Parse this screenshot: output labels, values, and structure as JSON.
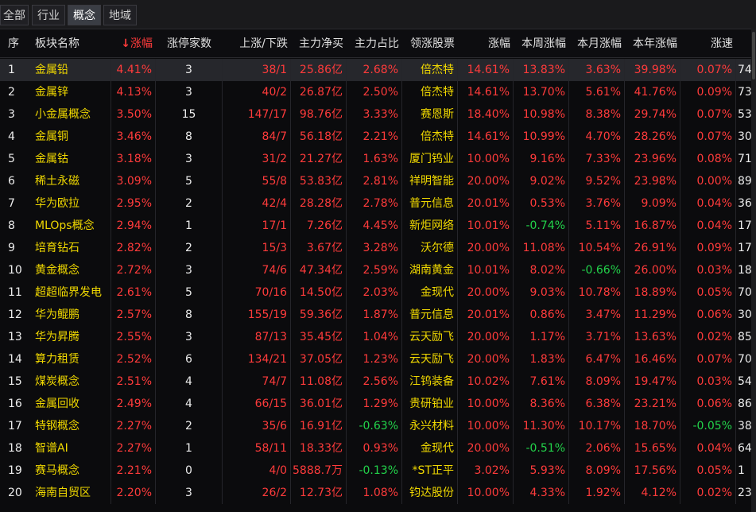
{
  "tabs": [
    {
      "label": "全部",
      "active": false
    },
    {
      "label": "行业",
      "active": false
    },
    {
      "label": "概念",
      "active": true
    },
    {
      "label": "地域",
      "active": false
    }
  ],
  "header": {
    "seq": "序",
    "name": "板块名称",
    "sort_arrow": "↓",
    "change": "涨幅",
    "limit_up": "涨停家数",
    "up_down": "上涨/下跌",
    "net_inflow": "主力净买",
    "main_ratio": "主力占比",
    "leader": "领涨股票",
    "leader_change": "涨幅",
    "week": "本周涨幅",
    "month": "本月涨幅",
    "year": "本年涨幅",
    "speed": "涨速",
    "extra": ""
  },
  "rows": [
    {
      "seq": "1",
      "name": "金属铅",
      "change": "4.41%",
      "limit_up": "3",
      "up_down": "38/1",
      "net": "25.86亿",
      "ratio": "2.68%",
      "leader": "倍杰特",
      "lchg": "14.61%",
      "week": "13.83%",
      "month": "3.63%",
      "year": "39.98%",
      "speed": "0.07%",
      "extra": "74"
    },
    {
      "seq": "2",
      "name": "金属锌",
      "change": "4.13%",
      "limit_up": "3",
      "up_down": "40/2",
      "net": "26.87亿",
      "ratio": "2.50%",
      "leader": "倍杰特",
      "lchg": "14.61%",
      "week": "13.70%",
      "month": "5.61%",
      "year": "41.76%",
      "speed": "0.09%",
      "extra": "73"
    },
    {
      "seq": "3",
      "name": "小金属概念",
      "change": "3.50%",
      "limit_up": "15",
      "up_down": "147/17",
      "net": "98.76亿",
      "ratio": "3.33%",
      "leader": "赛恩斯",
      "lchg": "18.40%",
      "week": "10.98%",
      "month": "8.38%",
      "year": "29.74%",
      "speed": "0.07%",
      "extra": "53"
    },
    {
      "seq": "4",
      "name": "金属铜",
      "change": "3.46%",
      "limit_up": "8",
      "up_down": "84/7",
      "net": "56.18亿",
      "ratio": "2.21%",
      "leader": "倍杰特",
      "lchg": "14.61%",
      "week": "10.99%",
      "month": "4.70%",
      "year": "28.26%",
      "speed": "0.07%",
      "extra": "30"
    },
    {
      "seq": "5",
      "name": "金属钴",
      "change": "3.18%",
      "limit_up": "3",
      "up_down": "31/2",
      "net": "21.27亿",
      "ratio": "1.63%",
      "leader": "厦门钨业",
      "lchg": "10.00%",
      "week": "9.16%",
      "month": "7.33%",
      "year": "23.96%",
      "speed": "0.08%",
      "extra": "71"
    },
    {
      "seq": "6",
      "name": "稀土永磁",
      "change": "3.09%",
      "limit_up": "5",
      "up_down": "55/8",
      "net": "53.83亿",
      "ratio": "2.81%",
      "leader": "祥明智能",
      "lchg": "20.00%",
      "week": "9.02%",
      "month": "9.52%",
      "year": "23.98%",
      "speed": "0.00%",
      "extra": "89"
    },
    {
      "seq": "7",
      "name": "华为欧拉",
      "change": "2.95%",
      "limit_up": "2",
      "up_down": "42/4",
      "net": "28.28亿",
      "ratio": "2.78%",
      "leader": "普元信息",
      "lchg": "20.01%",
      "week": "0.53%",
      "month": "3.76%",
      "year": "9.09%",
      "speed": "0.04%",
      "extra": "36"
    },
    {
      "seq": "8",
      "name": "MLOps概念",
      "change": "2.94%",
      "limit_up": "1",
      "up_down": "17/1",
      "net": "7.26亿",
      "ratio": "4.45%",
      "leader": "新炬网络",
      "lchg": "10.01%",
      "week": "-0.74%",
      "month": "5.11%",
      "year": "16.87%",
      "speed": "0.04%",
      "extra": "17"
    },
    {
      "seq": "9",
      "name": "培育钻石",
      "change": "2.82%",
      "limit_up": "2",
      "up_down": "15/3",
      "net": "3.67亿",
      "ratio": "3.28%",
      "leader": "沃尔德",
      "lchg": "20.00%",
      "week": "11.08%",
      "month": "10.54%",
      "year": "26.91%",
      "speed": "0.09%",
      "extra": "17"
    },
    {
      "seq": "10",
      "name": "黄金概念",
      "change": "2.72%",
      "limit_up": "3",
      "up_down": "74/6",
      "net": "47.34亿",
      "ratio": "2.59%",
      "leader": "湖南黄金",
      "lchg": "10.01%",
      "week": "8.02%",
      "month": "-0.66%",
      "year": "26.00%",
      "speed": "0.03%",
      "extra": "18"
    },
    {
      "seq": "11",
      "name": "超超临界发电",
      "change": "2.61%",
      "limit_up": "5",
      "up_down": "70/16",
      "net": "14.50亿",
      "ratio": "2.03%",
      "leader": "金现代",
      "lchg": "20.00%",
      "week": "9.03%",
      "month": "10.78%",
      "year": "18.89%",
      "speed": "0.05%",
      "extra": "70"
    },
    {
      "seq": "12",
      "name": "华为鲲鹏",
      "change": "2.57%",
      "limit_up": "8",
      "up_down": "155/19",
      "net": "59.36亿",
      "ratio": "1.87%",
      "leader": "普元信息",
      "lchg": "20.01%",
      "week": "0.86%",
      "month": "3.47%",
      "year": "11.29%",
      "speed": "0.06%",
      "extra": "30"
    },
    {
      "seq": "13",
      "name": "华为昇腾",
      "change": "2.55%",
      "limit_up": "3",
      "up_down": "87/13",
      "net": "35.45亿",
      "ratio": "1.04%",
      "leader": "云天励飞",
      "lchg": "20.00%",
      "week": "1.17%",
      "month": "3.71%",
      "year": "13.63%",
      "speed": "0.02%",
      "extra": "85"
    },
    {
      "seq": "14",
      "name": "算力租赁",
      "change": "2.52%",
      "limit_up": "6",
      "up_down": "134/21",
      "net": "37.05亿",
      "ratio": "1.23%",
      "leader": "云天励飞",
      "lchg": "20.00%",
      "week": "1.83%",
      "month": "6.47%",
      "year": "16.46%",
      "speed": "0.07%",
      "extra": "70"
    },
    {
      "seq": "15",
      "name": "煤炭概念",
      "change": "2.51%",
      "limit_up": "4",
      "up_down": "74/7",
      "net": "11.08亿",
      "ratio": "2.56%",
      "leader": "江钨装备",
      "lchg": "10.02%",
      "week": "7.61%",
      "month": "8.09%",
      "year": "19.47%",
      "speed": "0.03%",
      "extra": "54"
    },
    {
      "seq": "16",
      "name": "金属回收",
      "change": "2.49%",
      "limit_up": "4",
      "up_down": "66/15",
      "net": "36.01亿",
      "ratio": "1.29%",
      "leader": "贵研铂业",
      "lchg": "10.00%",
      "week": "8.36%",
      "month": "6.38%",
      "year": "23.21%",
      "speed": "0.06%",
      "extra": "86"
    },
    {
      "seq": "17",
      "name": "特钢概念",
      "change": "2.27%",
      "limit_up": "2",
      "up_down": "35/6",
      "net": "16.91亿",
      "ratio": "-0.63%",
      "leader": "永兴材料",
      "lchg": "10.00%",
      "week": "11.30%",
      "month": "10.17%",
      "year": "18.70%",
      "speed": "-0.05%",
      "extra": "38"
    },
    {
      "seq": "18",
      "name": "智谱AI",
      "change": "2.27%",
      "limit_up": "1",
      "up_down": "58/11",
      "net": "18.33亿",
      "ratio": "0.93%",
      "leader": "金现代",
      "lchg": "20.00%",
      "week": "-0.51%",
      "month": "2.06%",
      "year": "15.65%",
      "speed": "0.04%",
      "extra": "64"
    },
    {
      "seq": "19",
      "name": "赛马概念",
      "change": "2.21%",
      "limit_up": "0",
      "up_down": "4/0",
      "net": "5888.7万",
      "ratio": "-0.13%",
      "leader": "*ST正平",
      "lchg": "3.02%",
      "week": "5.93%",
      "month": "8.09%",
      "year": "17.56%",
      "speed": "0.05%",
      "extra": "1"
    },
    {
      "seq": "20",
      "name": "海南自贸区",
      "change": "2.20%",
      "limit_up": "3",
      "up_down": "26/2",
      "net": "12.73亿",
      "ratio": "1.08%",
      "leader": "钧达股份",
      "lchg": "10.00%",
      "week": "4.33%",
      "month": "1.92%",
      "year": "4.12%",
      "speed": "0.02%",
      "extra": "23"
    }
  ],
  "colors": {
    "up": "#ff3b3b",
    "down": "#22d34a",
    "name": "#f0d800",
    "selected_row": "#26272c"
  }
}
